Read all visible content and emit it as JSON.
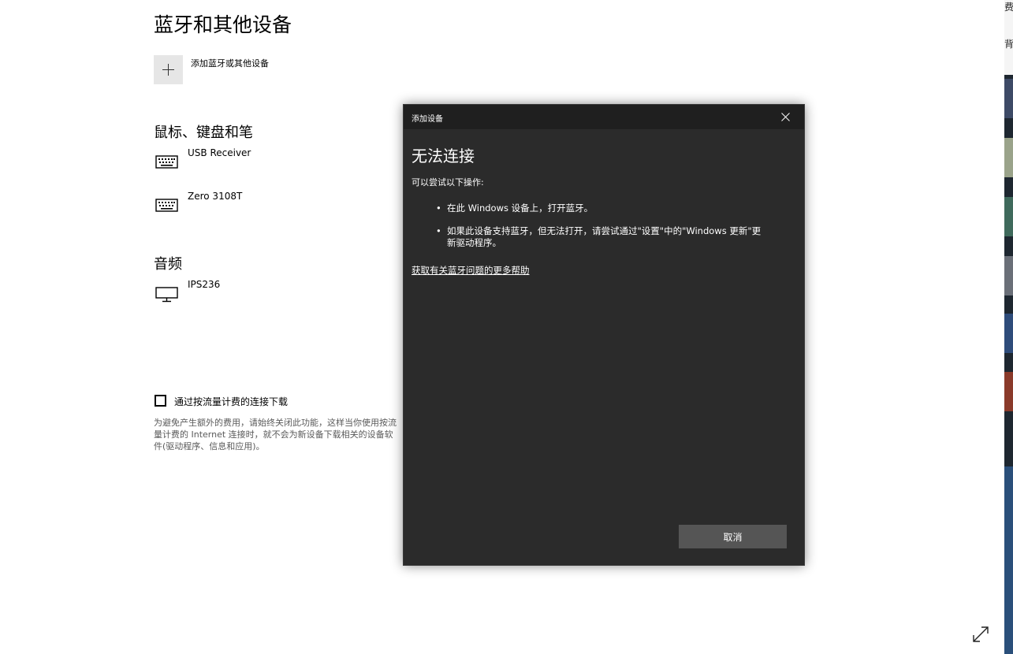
{
  "page": {
    "title": "蓝牙和其他设备",
    "add_device_label": "添加蓝牙或其他设备"
  },
  "sections": {
    "input": {
      "title": "鼠标、键盘和笔",
      "devices": [
        {
          "name": "USB Receiver",
          "icon": "keyboard-icon"
        },
        {
          "name": "Zero 3108T",
          "icon": "keyboard-icon"
        }
      ]
    },
    "audio": {
      "title": "音频",
      "devices": [
        {
          "name": "IPS236",
          "icon": "monitor-icon"
        }
      ]
    }
  },
  "metered": {
    "checkbox_label": "通过按流量计费的连接下载",
    "checked": false,
    "description": "为避免产生额外的费用，请始终关闭此功能，这样当你使用按流量计费的 Internet 连接时，就不会为新设备下载相关的设备软件(驱动程序、信息和应用)。"
  },
  "right_strip_text": [
    "费",
    "背"
  ],
  "dialog": {
    "window_title": "添加设备",
    "heading": "无法连接",
    "intro": "可以尝试以下操作:",
    "bullets": [
      "在此 Windows 设备上，打开蓝牙。",
      "如果此设备支持蓝牙，但无法打开，请尝试通过\"设置\"中的\"Windows 更新\"更新驱动程序。"
    ],
    "help_link": "获取有关蓝牙问题的更多帮助",
    "cancel_label": "取消"
  },
  "colors": {
    "dialog_bg": "#2b2b2b",
    "dialog_titlebar": "#1f1f1f",
    "cancel_button": "#555555",
    "add_tile": "#e6e6e6",
    "page_bg": "#ffffff"
  }
}
